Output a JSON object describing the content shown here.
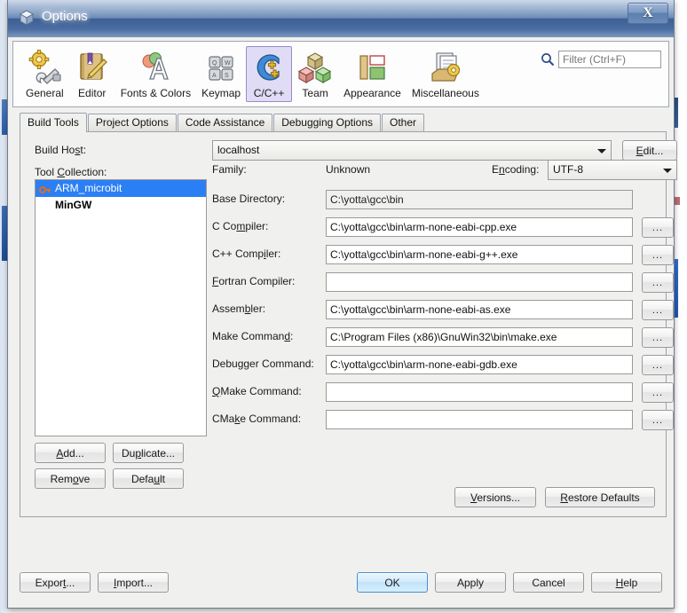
{
  "window": {
    "title": "Options",
    "title_icon": "cube-icon",
    "close_label": "X"
  },
  "toolbar": {
    "items": [
      {
        "label": "General",
        "icon": "gear-wrench-icon"
      },
      {
        "label": "Editor",
        "icon": "notebook-pencil-icon"
      },
      {
        "label": "Fonts & Colors",
        "icon": "font-palette-icon"
      },
      {
        "label": "Keymap",
        "icon": "keyboard-keys-icon"
      },
      {
        "label": "C/C++",
        "icon": "c-plusplus-icon",
        "selected": true
      },
      {
        "label": "Team",
        "icon": "cubes-icon"
      },
      {
        "label": "Appearance",
        "icon": "layout-blocks-icon"
      },
      {
        "label": "Miscellaneous",
        "icon": "documents-gear-icon"
      }
    ],
    "filter": {
      "icon": "search-icon",
      "placeholder": "Filter (Ctrl+F)",
      "value": ""
    }
  },
  "tabs": [
    {
      "label": "Build Tools",
      "active": true
    },
    {
      "label": "Project Options",
      "active": false
    },
    {
      "label": "Code Assistance",
      "active": false
    },
    {
      "label": "Debugging Options",
      "active": false
    },
    {
      "label": "Other",
      "active": false
    }
  ],
  "panel": {
    "build_host": {
      "label": "Build Host:",
      "mnemonic": "s",
      "value": "localhost",
      "edit_button": "Edit...",
      "edit_mnemonic": "E"
    },
    "tool_collection": {
      "label": "Tool Collection:",
      "mnemonic": "C",
      "items": [
        {
          "name": "ARM_microbit",
          "icon": "key-icon",
          "selected": true,
          "bold": false
        },
        {
          "name": "MinGW",
          "icon": "",
          "selected": false,
          "bold": true
        }
      ],
      "buttons": [
        {
          "label": "Add...",
          "mnemonic": "A"
        },
        {
          "label": "Duplicate...",
          "mnemonic": "p"
        },
        {
          "label": "Remove",
          "mnemonic": "o"
        },
        {
          "label": "Default",
          "mnemonic": "u"
        }
      ]
    },
    "family": {
      "label": "Family:",
      "value": "Unknown"
    },
    "encoding": {
      "label": "Encoding:",
      "mnemonic": "n",
      "value": "UTF-8"
    },
    "fields": [
      {
        "label": "Base Directory:",
        "mnemonic": "",
        "value": "C:\\yotta\\gcc\\bin",
        "browse": false,
        "disabled": true
      },
      {
        "label": "C Compiler:",
        "mnemonic": "m",
        "value": "C:\\yotta\\gcc\\bin\\arm-none-eabi-cpp.exe",
        "browse": true,
        "disabled": false
      },
      {
        "label": "C++ Compiler:",
        "mnemonic": "l",
        "value": "C:\\yotta\\gcc\\bin\\arm-none-eabi-g++.exe",
        "browse": true,
        "disabled": false
      },
      {
        "label": "Fortran Compiler:",
        "mnemonic": "F",
        "value": "",
        "browse": true,
        "disabled": false
      },
      {
        "label": "Assembler:",
        "mnemonic": "b",
        "value": "C:\\yotta\\gcc\\bin\\arm-none-eabi-as.exe",
        "browse": true,
        "disabled": false
      },
      {
        "label": "Make Command:",
        "mnemonic": "d",
        "value": "C:\\Program Files (x86)\\GnuWin32\\bin\\make.exe",
        "browse": true,
        "disabled": false
      },
      {
        "label": "Debugger Command:",
        "mnemonic": "g",
        "value": "C:\\yotta\\gcc\\bin\\arm-none-eabi-gdb.exe",
        "browse": true,
        "disabled": false
      },
      {
        "label": "QMake Command:",
        "mnemonic": "Q",
        "value": "",
        "browse": true,
        "disabled": false
      },
      {
        "label": "CMake Command:",
        "mnemonic": "k",
        "value": "",
        "browse": true,
        "disabled": false
      }
    ],
    "browse_label": "...",
    "panel_buttons": [
      {
        "label": "Versions...",
        "mnemonic": "V"
      },
      {
        "label": "Restore Defaults",
        "mnemonic": "R"
      }
    ]
  },
  "footer": {
    "left": [
      {
        "label": "Export...",
        "mnemonic": "t"
      },
      {
        "label": "Import...",
        "mnemonic": "I"
      }
    ],
    "right": [
      {
        "label": "OK",
        "mnemonic": "",
        "default": true
      },
      {
        "label": "Apply",
        "mnemonic": "",
        "default": false
      },
      {
        "label": "Cancel",
        "mnemonic": "",
        "default": false
      },
      {
        "label": "Help",
        "mnemonic": "H",
        "default": false
      }
    ]
  },
  "colors": {
    "selection_blue": "#2b7ff5",
    "tab_selected_bg": "#e1dcf5",
    "tab_selected_border": "#9b8ac4",
    "default_button_border": "#4b8ed1",
    "dialog_bg": "#f0f0ee"
  }
}
